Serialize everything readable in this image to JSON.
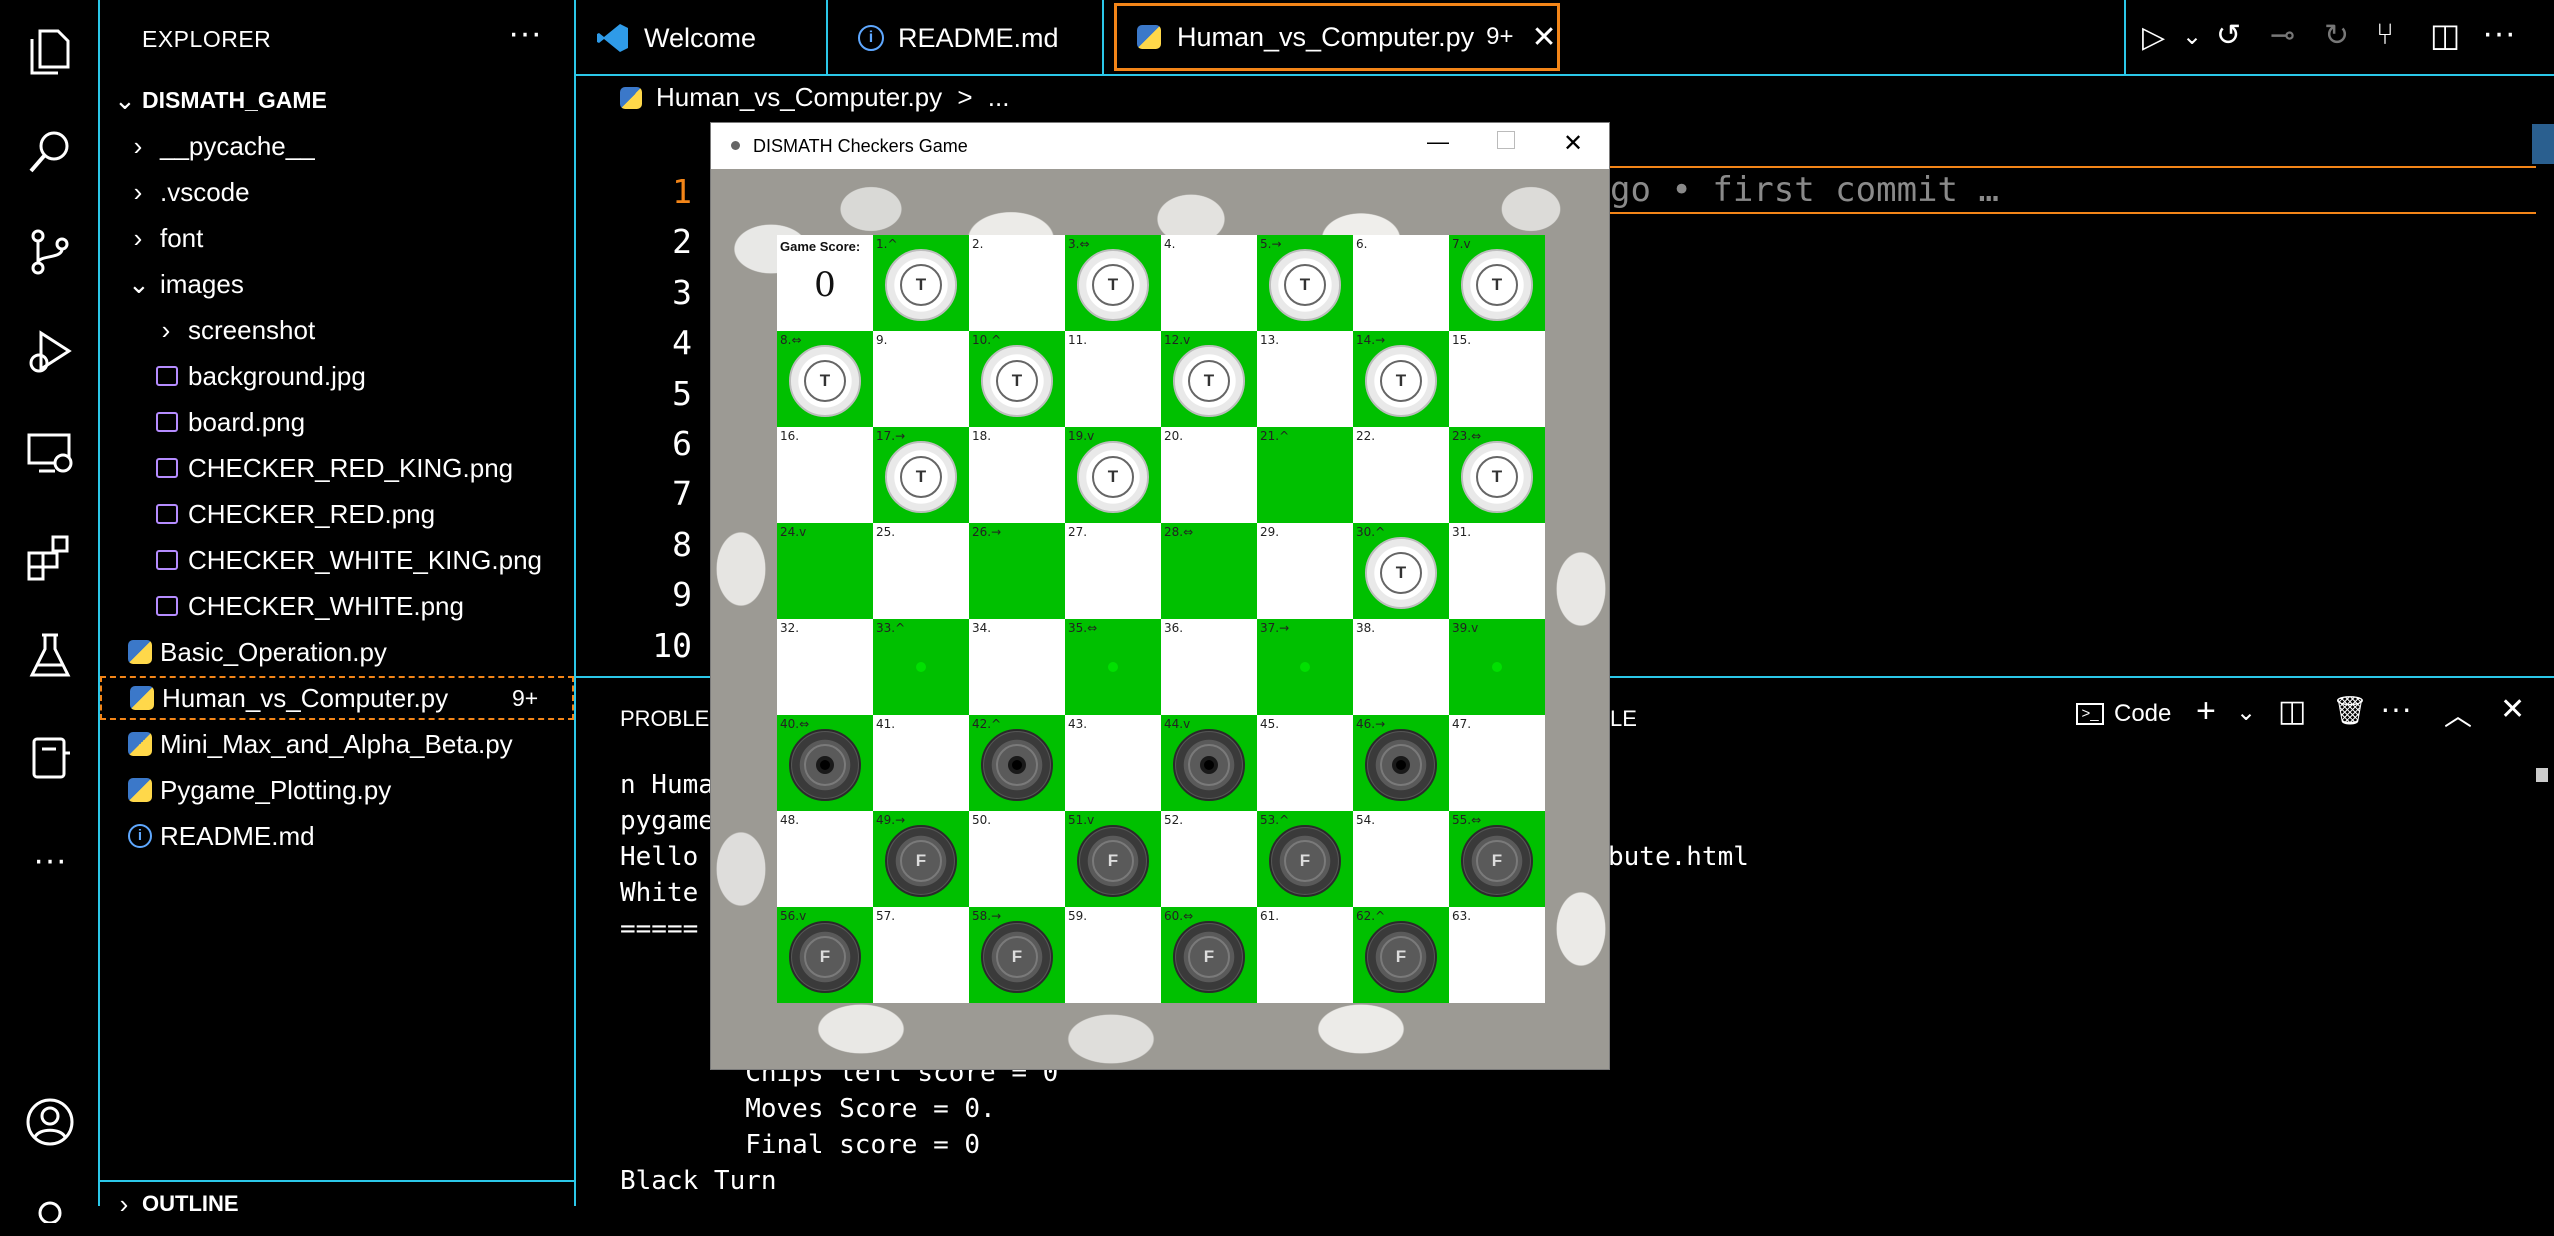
{
  "explorer": {
    "title": "EXPLORER",
    "more": "···",
    "root": "DISMATH_GAME",
    "items": [
      {
        "label": "__pycache__",
        "kind": "folder",
        "open": false,
        "level": 1
      },
      {
        "label": ".vscode",
        "kind": "folder",
        "open": false,
        "level": 1
      },
      {
        "label": "font",
        "kind": "folder",
        "open": false,
        "level": 1
      },
      {
        "label": "images",
        "kind": "folder",
        "open": true,
        "level": 1
      },
      {
        "label": "screenshot",
        "kind": "folder",
        "open": false,
        "level": 2
      },
      {
        "label": "background.jpg",
        "kind": "image",
        "level": 2
      },
      {
        "label": "board.png",
        "kind": "image",
        "level": 2
      },
      {
        "label": "CHECKER_RED_KING.png",
        "kind": "image",
        "level": 2
      },
      {
        "label": "CHECKER_RED.png",
        "kind": "image",
        "level": 2
      },
      {
        "label": "CHECKER_WHITE_KING.png",
        "kind": "image",
        "level": 2
      },
      {
        "label": "CHECKER_WHITE.png",
        "kind": "image",
        "level": 2
      },
      {
        "label": "Basic_Operation.py",
        "kind": "python",
        "level": 1
      },
      {
        "label": "Human_vs_Computer.py",
        "kind": "python",
        "level": 1,
        "badge": "9+",
        "selected": true
      },
      {
        "label": "Mini_Max_and_Alpha_Beta.py",
        "kind": "python",
        "level": 1
      },
      {
        "label": "Pygame_Plotting.py",
        "kind": "python",
        "level": 1
      },
      {
        "label": "README.md",
        "kind": "info",
        "level": 1
      }
    ],
    "outline": "OUTLINE"
  },
  "tabs": [
    {
      "label": "Welcome",
      "icon": "vscode-icon"
    },
    {
      "label": "README.md",
      "icon": "info-icon"
    },
    {
      "label": "Human_vs_Computer.py",
      "icon": "python-icon",
      "badge": "9+",
      "active": true
    }
  ],
  "breadcrumb": {
    "file": "Human_vs_Computer.py",
    "sep": ">",
    "rest": "..."
  },
  "editor": {
    "line_numbers": [
      "1",
      "2",
      "3",
      "4",
      "5",
      "6",
      "7",
      "8",
      "9",
      "10"
    ],
    "ghost_text": "go • first commit …"
  },
  "panel": {
    "problems_tab": "PROBLEM",
    "le_tab": "LE",
    "code_label": "Code",
    "terminal_lines": [
      "n Huma",
      "pygame",
      "Hello",
      "White",
      "====="
    ],
    "terminal_suffix": "bute.html",
    "score_lines": [
      "        Chips left score = 0",
      "        Moves Score = 0.",
      "        Final score = 0",
      "Black Turn"
    ]
  },
  "game": {
    "title": "DISMATH Checkers Game",
    "score_label": "Game Score:",
    "score_value": "0",
    "cells": [
      {
        "n": "1.",
        "a": "^",
        "p": "T"
      },
      {
        "n": "2."
      },
      {
        "n": "3.",
        "a": "⇔",
        "p": "T"
      },
      {
        "n": "4."
      },
      {
        "n": "5.",
        "a": "→",
        "p": "T"
      },
      {
        "n": "6."
      },
      {
        "n": "7.",
        "a": "v",
        "p": "T"
      },
      {
        "n": "8.",
        "a": "⇔",
        "p": "T"
      },
      {
        "n": "9."
      },
      {
        "n": "10.",
        "a": "^",
        "p": "T"
      },
      {
        "n": "11."
      },
      {
        "n": "12.",
        "a": "v",
        "p": "T"
      },
      {
        "n": "13."
      },
      {
        "n": "14.",
        "a": "→",
        "p": "T"
      },
      {
        "n": "15."
      },
      {
        "n": "16."
      },
      {
        "n": "17.",
        "a": "→",
        "p": "T"
      },
      {
        "n": "18."
      },
      {
        "n": "19.",
        "a": "v",
        "p": "T"
      },
      {
        "n": "20."
      },
      {
        "n": "21.",
        "a": "^"
      },
      {
        "n": "22."
      },
      {
        "n": "23.",
        "a": "⇔",
        "p": "T"
      },
      {
        "n": "24.",
        "a": "v"
      },
      {
        "n": "25."
      },
      {
        "n": "26.",
        "a": "→"
      },
      {
        "n": "27."
      },
      {
        "n": "28.",
        "a": "⇔"
      },
      {
        "n": "29."
      },
      {
        "n": "30.",
        "a": "^",
        "p": "T"
      },
      {
        "n": "31."
      },
      {
        "n": "32."
      },
      {
        "n": "33.",
        "a": "^",
        "h": true
      },
      {
        "n": "34."
      },
      {
        "n": "35.",
        "a": "⇔",
        "h": true
      },
      {
        "n": "36."
      },
      {
        "n": "37.",
        "a": "→",
        "h": true
      },
      {
        "n": "38."
      },
      {
        "n": "39.",
        "a": "v",
        "h": true
      },
      {
        "n": "40.",
        "a": "⇔",
        "p": "B"
      },
      {
        "n": "41."
      },
      {
        "n": "42.",
        "a": "^",
        "p": "B"
      },
      {
        "n": "43."
      },
      {
        "n": "44.",
        "a": "v",
        "p": "B"
      },
      {
        "n": "45."
      },
      {
        "n": "46.",
        "a": "→",
        "p": "B"
      },
      {
        "n": "47."
      },
      {
        "n": "48."
      },
      {
        "n": "49.",
        "a": "→",
        "p": "F"
      },
      {
        "n": "50."
      },
      {
        "n": "51.",
        "a": "v",
        "p": "F"
      },
      {
        "n": "52."
      },
      {
        "n": "53.",
        "a": "^",
        "p": "F"
      },
      {
        "n": "54."
      },
      {
        "n": "55.",
        "a": "⇔",
        "p": "F"
      },
      {
        "n": "56.",
        "a": "v",
        "p": "F"
      },
      {
        "n": "57."
      },
      {
        "n": "58.",
        "a": "→",
        "p": "F"
      },
      {
        "n": "59."
      },
      {
        "n": "60.",
        "a": "⇔",
        "p": "F"
      },
      {
        "n": "61."
      },
      {
        "n": "62.",
        "a": "^",
        "p": "F"
      },
      {
        "n": "63."
      }
    ]
  },
  "colors": {
    "accent_border": "#2bc7e8",
    "active_tab_border": "#f38518",
    "board_dark": "#00c000",
    "board_light": "#ffffff",
    "hint": "#00e000"
  }
}
